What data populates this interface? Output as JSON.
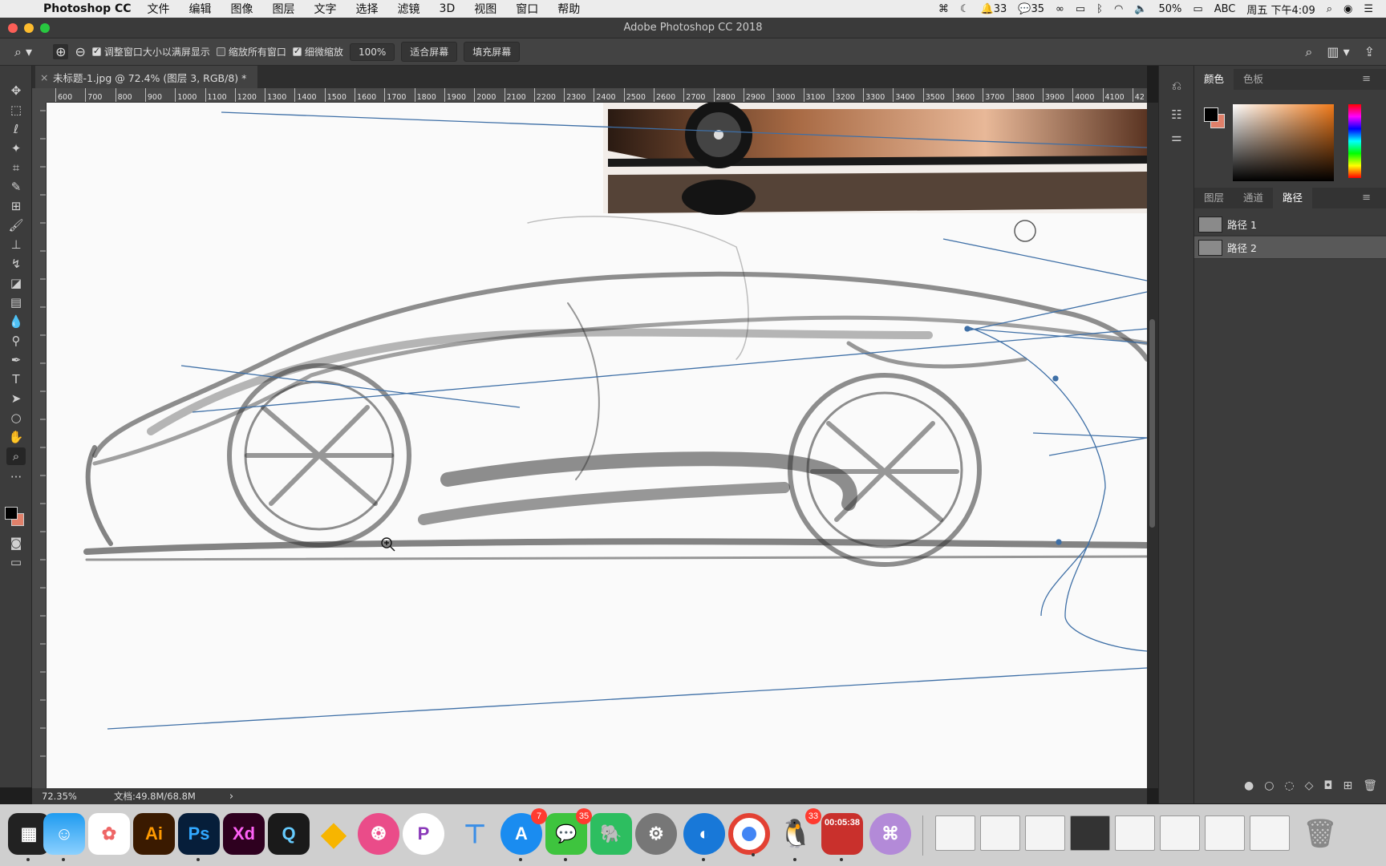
{
  "menubar": {
    "app": "Photoshop CC",
    "items": [
      "文件",
      "编辑",
      "图像",
      "图层",
      "文字",
      "选择",
      "滤镜",
      "3D",
      "视图",
      "窗口",
      "帮助"
    ],
    "status": {
      "notif_count": "33",
      "wechat_count": "35",
      "battery": "50%",
      "input": "ABC",
      "clock": "周五 下午4:09"
    }
  },
  "window": {
    "title": "Adobe Photoshop CC 2018"
  },
  "options": {
    "resize_window": "调整窗口大小以满屏显示",
    "zoom_all": "缩放所有窗口",
    "scrubby": "细微缩放",
    "zoom_value": "100%",
    "fit_screen": "适合屏幕",
    "fill_screen": "填充屏幕"
  },
  "document": {
    "tab_title": "未标题-1.jpg @ 72.4% (图层 3, RGB/8) *"
  },
  "ruler": {
    "labels": [
      "600",
      "700",
      "800",
      "900",
      "1000",
      "1100",
      "1200",
      "1300",
      "1400",
      "1500",
      "1600",
      "1700",
      "1800",
      "1900",
      "2000",
      "2100",
      "2200",
      "2300",
      "2400",
      "2500",
      "2600",
      "2700",
      "2800",
      "2900",
      "3000",
      "3100",
      "3200",
      "3300",
      "3400",
      "3500",
      "3600",
      "3700",
      "3800",
      "3900",
      "4000",
      "4100",
      "42"
    ]
  },
  "status": {
    "zoom": "72.35%",
    "doc": "文档:49.8M/68.8M",
    "arrow": "›"
  },
  "panels": {
    "color_tabs": [
      "颜色",
      "色板"
    ],
    "layer_tabs": [
      "图层",
      "通道",
      "路径"
    ],
    "paths": [
      "路径 1",
      "路径 2"
    ],
    "colors": {
      "foreground": "#000000",
      "background": "#e0806a",
      "accent": "#f07a1a"
    }
  },
  "dock": {
    "badges": {
      "appstore": "7",
      "wechat": "35",
      "qq": "33"
    },
    "timer": "00:05:38",
    "apps": [
      "Launchpad",
      "Finder",
      "Photos",
      "Ai",
      "Ps",
      "Xd",
      "QuickTime",
      "Sketch",
      "Dribbble",
      "PicsArt",
      "Keynote",
      "App Store",
      "WeChat",
      "Evernote",
      "System Preferences",
      "Migrate",
      "Chrome",
      "QQ",
      "Recorder",
      "Keyboard"
    ]
  }
}
